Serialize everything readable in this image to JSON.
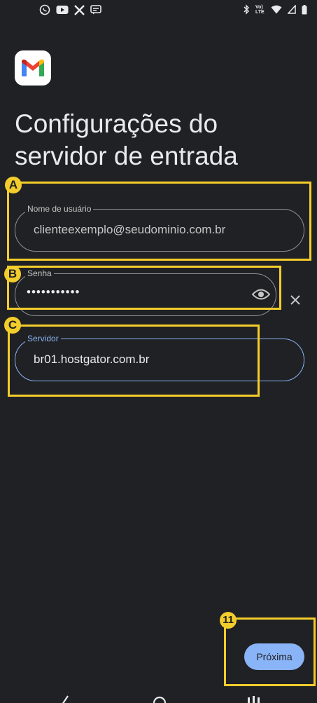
{
  "status_bar": {
    "left_icons": [
      "whatsapp-icon",
      "youtube-icon",
      "x-icon",
      "messages-icon"
    ],
    "right_icons": [
      "bluetooth-icon",
      "volte-icon",
      "wifi-icon",
      "cell-signal-icon",
      "battery-icon"
    ],
    "volte_text": "Vo) LTE"
  },
  "app": {
    "logo": "gmail-logo"
  },
  "page": {
    "title": "Configurações do servidor de entrada"
  },
  "form": {
    "username": {
      "label": "Nome de usuário",
      "value": "clienteexemplo@seudominio.com.br"
    },
    "password": {
      "label": "Senha",
      "value": "•••••••••••"
    },
    "server": {
      "label": "Servidor",
      "value": "br01.hostgator.com.br"
    }
  },
  "annotations": {
    "a": "A",
    "b": "B",
    "c": "C",
    "step": "11"
  },
  "actions": {
    "next_label": "Próxima"
  },
  "colors": {
    "background": "#202124",
    "accent": "#8ab4f8",
    "callout": "#f3cd2b"
  }
}
